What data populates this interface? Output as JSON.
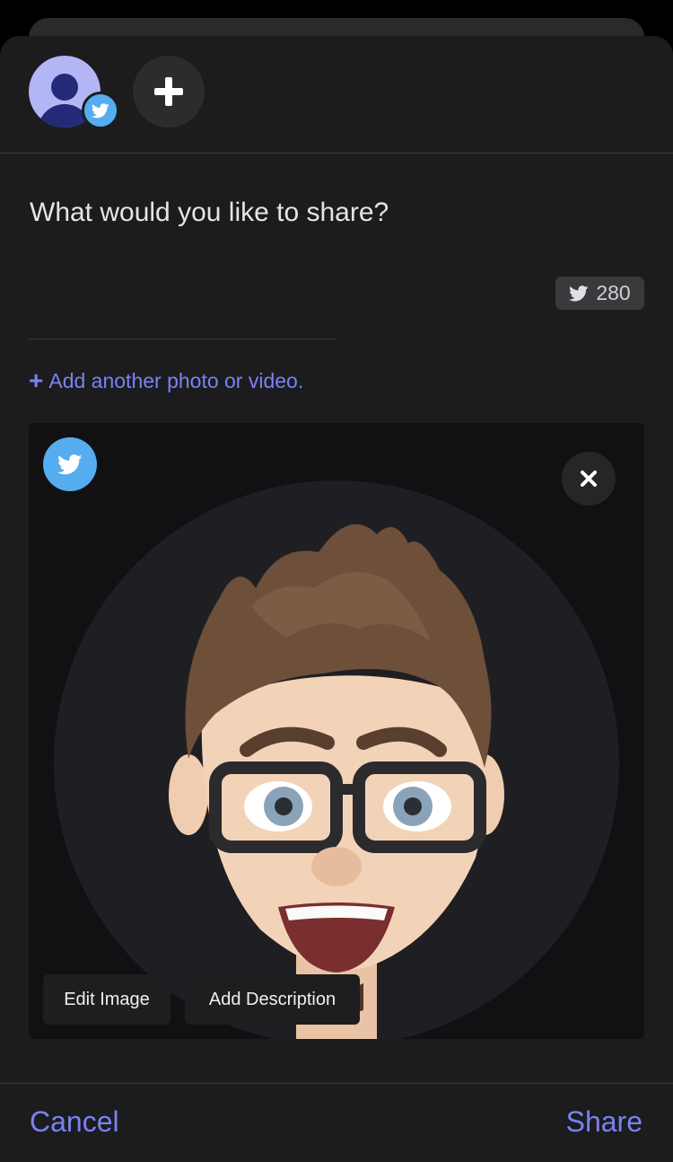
{
  "composer": {
    "prompt": "What would you like to share?",
    "char_count": "280"
  },
  "media": {
    "add_more": "Add another photo or video.",
    "edit_image": "Edit Image",
    "add_description": "Add Description"
  },
  "footer": {
    "cancel": "Cancel",
    "share": "Share"
  },
  "colors": {
    "accent": "#7a82f2",
    "twitter": "#55acee",
    "sheet_bg": "#1c1c1e"
  },
  "icons": [
    "twitter-bird-icon",
    "plus-icon",
    "close-icon",
    "user-avatar"
  ]
}
